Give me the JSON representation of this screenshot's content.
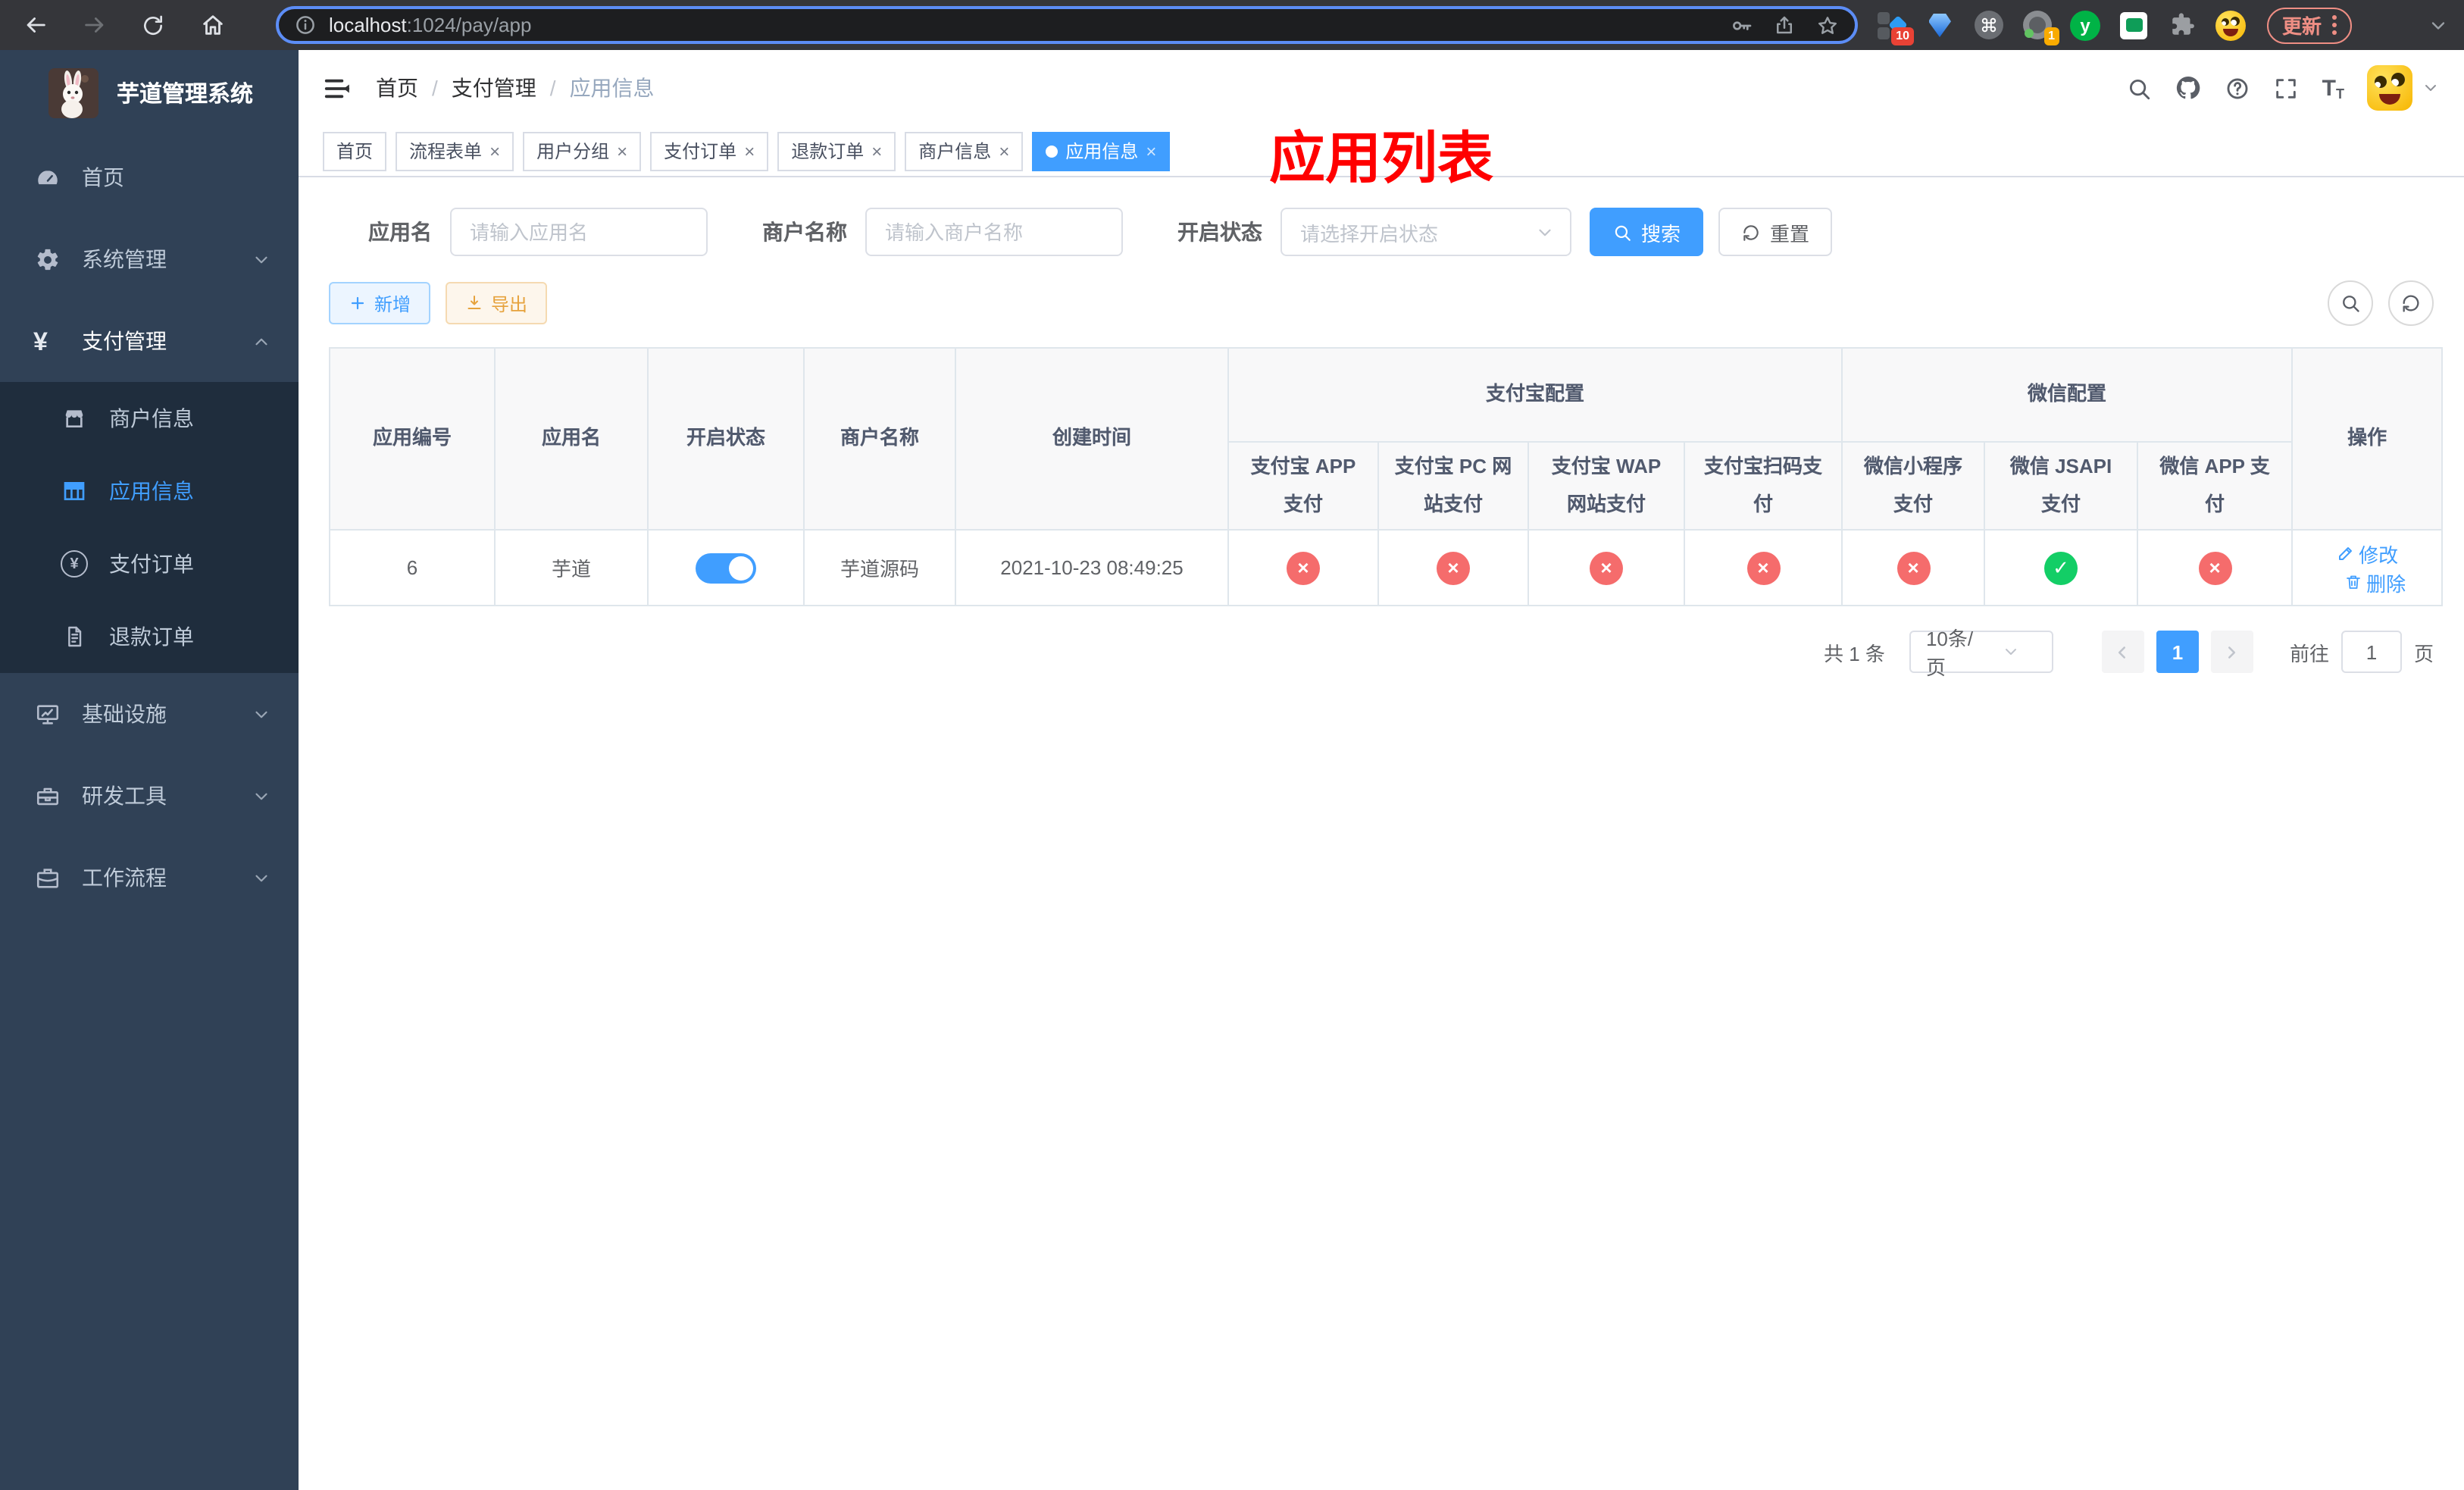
{
  "browser": {
    "url": {
      "host": "localhost",
      "rest": ":1024/pay/app"
    },
    "update_button": "更新",
    "extension_badges": {
      "first": "10",
      "second": "1"
    }
  },
  "sidebar": {
    "title": "芋道管理系统",
    "menu": [
      {
        "label": "首页"
      },
      {
        "label": "系统管理"
      },
      {
        "label": "支付管理"
      }
    ],
    "submenu": [
      {
        "label": "商户信息"
      },
      {
        "label": "应用信息"
      },
      {
        "label": "支付订单"
      },
      {
        "label": "退款订单"
      }
    ],
    "menu_bottom": [
      {
        "label": "基础设施"
      },
      {
        "label": "研发工具"
      },
      {
        "label": "工作流程"
      }
    ]
  },
  "navbar": {
    "breadcrumb": [
      "首页",
      "支付管理",
      "应用信息"
    ],
    "overlay_title": "应用列表"
  },
  "tabs": [
    {
      "label": "首页"
    },
    {
      "label": "流程表单"
    },
    {
      "label": "用户分组"
    },
    {
      "label": "支付订单"
    },
    {
      "label": "退款订单"
    },
    {
      "label": "商户信息"
    },
    {
      "label": "应用信息"
    }
  ],
  "search": {
    "app_name_label": "应用名",
    "app_name_placeholder": "请输入应用名",
    "merchant_label": "商户名称",
    "merchant_placeholder": "请输入商户名称",
    "status_label": "开启状态",
    "status_placeholder": "请选择开启状态",
    "search_button": "搜索",
    "reset_button": "重置"
  },
  "toolbar": {
    "add_button": "新增",
    "export_button": "导出"
  },
  "table": {
    "columns": {
      "app_id": "应用编号",
      "app_name": "应用名",
      "enabled": "开启状态",
      "merchant": "商户名称",
      "created": "创建时间",
      "group_alipay": "支付宝配置",
      "group_wechat": "微信配置",
      "alipay_app": "支付宝 APP 支付",
      "alipay_pc": "支付宝 PC 网站支付",
      "alipay_wap": "支付宝 WAP 网站支付",
      "alipay_qr": "支付宝扫码支付",
      "wx_lite": "微信小程序支付",
      "wx_jsapi": "微信 JSAPI 支付",
      "wx_app": "微信 APP 支付",
      "actions": "操作"
    },
    "row": {
      "app_id": "6",
      "app_name": "芋道",
      "enabled": true,
      "merchant": "芋道源码",
      "created": "2021-10-23 08:49:25",
      "statuses": [
        "fail",
        "fail",
        "fail",
        "fail",
        "fail",
        "ok",
        "fail"
      ]
    },
    "edit_link": "修改",
    "delete_link": "删除"
  },
  "pagination": {
    "total": "共 1 条",
    "page_size": "10条/页",
    "page": "1",
    "goto_label": "前往",
    "goto_value": "1",
    "unit_label": "页"
  },
  "colors": {
    "accent_blue": "#409eff",
    "danger_red": "#f56c6c",
    "success_green": "#13ce66",
    "warning_orange": "#e6a23c",
    "overlay_title_red": "#ff0000",
    "sidebar_bg": "#304156",
    "submenu_bg": "#1f2d3d"
  }
}
